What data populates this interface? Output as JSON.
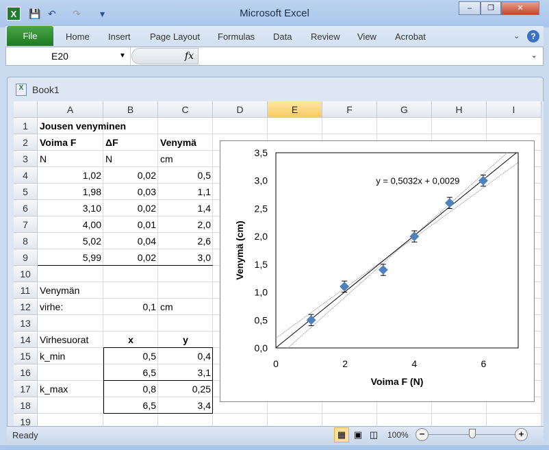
{
  "window": {
    "title": "Microsoft Excel",
    "minimize": "–",
    "restore": "❐",
    "close": "✕"
  },
  "qat": {
    "save": "💾",
    "undo": "↶",
    "redo": "↷",
    "customize": "▾"
  },
  "ribbon": {
    "tabs": [
      "File",
      "Home",
      "Insert",
      "Page Layout",
      "Formulas",
      "Data",
      "Review",
      "View",
      "Acrobat"
    ],
    "help": "?",
    "minimize": "♡"
  },
  "formula_bar": {
    "name_box": "E20",
    "fx": "fx",
    "value": ""
  },
  "workbook": {
    "title": "Book1"
  },
  "columns": [
    "A",
    "B",
    "C",
    "D",
    "E",
    "F",
    "G",
    "H",
    "I"
  ],
  "selected_column": "E",
  "rows": [
    "1",
    "2",
    "3",
    "4",
    "5",
    "6",
    "7",
    "8",
    "9",
    "10",
    "11",
    "12",
    "13",
    "14",
    "15",
    "16",
    "17",
    "18",
    "19"
  ],
  "cells": [
    {
      "ref": "A1",
      "v": "Jousen venyminen",
      "bold": true
    },
    {
      "ref": "A2",
      "v": "Voima F",
      "bold": true
    },
    {
      "ref": "B2",
      "v": "ΔF",
      "bold": true
    },
    {
      "ref": "C2",
      "v": "Venymä",
      "bold": true
    },
    {
      "ref": "A3",
      "v": "N"
    },
    {
      "ref": "B3",
      "v": "N"
    },
    {
      "ref": "C3",
      "v": "cm"
    },
    {
      "ref": "A4",
      "v": "1,02"
    },
    {
      "ref": "B4",
      "v": "0,02"
    },
    {
      "ref": "C4",
      "v": "0,5"
    },
    {
      "ref": "A5",
      "v": "1,98"
    },
    {
      "ref": "B5",
      "v": "0,03"
    },
    {
      "ref": "C5",
      "v": "1,1"
    },
    {
      "ref": "A6",
      "v": "3,10"
    },
    {
      "ref": "B6",
      "v": "0,02"
    },
    {
      "ref": "C6",
      "v": "1,4"
    },
    {
      "ref": "A7",
      "v": "4,00"
    },
    {
      "ref": "B7",
      "v": "0,01"
    },
    {
      "ref": "C7",
      "v": "2,0"
    },
    {
      "ref": "A8",
      "v": "5,02"
    },
    {
      "ref": "B8",
      "v": "0,04"
    },
    {
      "ref": "C8",
      "v": "2,6"
    },
    {
      "ref": "A9",
      "v": "5,99"
    },
    {
      "ref": "B9",
      "v": "0,02"
    },
    {
      "ref": "C9",
      "v": "3,0"
    },
    {
      "ref": "A11",
      "v": "Venymän"
    },
    {
      "ref": "A12",
      "v": "virhe:"
    },
    {
      "ref": "B12",
      "v": "0,1"
    },
    {
      "ref": "C12",
      "v": "cm"
    },
    {
      "ref": "A14",
      "v": "Virhesuorat"
    },
    {
      "ref": "B14",
      "v": "x",
      "bold": true,
      "center": true
    },
    {
      "ref": "C14",
      "v": "y",
      "bold": true,
      "center": true
    },
    {
      "ref": "A15",
      "v": "k_min"
    },
    {
      "ref": "B15",
      "v": "0,5"
    },
    {
      "ref": "C15",
      "v": "0,4"
    },
    {
      "ref": "B16",
      "v": "6,5"
    },
    {
      "ref": "C16",
      "v": "3,1"
    },
    {
      "ref": "A17",
      "v": "k_max"
    },
    {
      "ref": "B17",
      "v": "0,8"
    },
    {
      "ref": "C17",
      "v": "0,25"
    },
    {
      "ref": "B18",
      "v": "6,5"
    },
    {
      "ref": "C18",
      "v": "3,4"
    }
  ],
  "chart_data": {
    "type": "scatter",
    "xlabel": "Voima F (N)",
    "ylabel": "Venymä (cm)",
    "xlim": [
      0,
      7
    ],
    "ylim": [
      0,
      3.5
    ],
    "xticks": [
      "0",
      "2",
      "4",
      "6"
    ],
    "xtick_values": [
      0,
      2,
      4,
      6
    ],
    "yticks": [
      "0,0",
      "0,5",
      "1,0",
      "1,5",
      "2,0",
      "2,5",
      "3,0",
      "3,5"
    ],
    "ytick_values": [
      0,
      0.5,
      1,
      1.5,
      2,
      2.5,
      3,
      3.5
    ],
    "x": [
      1.02,
      1.98,
      3.1,
      4.0,
      5.02,
      5.99
    ],
    "y": [
      0.5,
      1.1,
      1.4,
      2.0,
      2.6,
      3.0
    ],
    "y_error": 0.1,
    "marker_color": "#4f81bd",
    "trendline": {
      "slope": 0.5032,
      "intercept": 0.0029,
      "label": "y = 0,5032x + 0,0029"
    },
    "error_lines": [
      {
        "points": [
          [
            0.5,
            0.4
          ],
          [
            6.5,
            3.1
          ]
        ]
      },
      {
        "points": [
          [
            0.8,
            0.25
          ],
          [
            6.5,
            3.4
          ]
        ]
      }
    ],
    "grid": false,
    "legend": "none"
  },
  "status": {
    "ready": "Ready",
    "zoom": "100%",
    "zoom_out": "−",
    "zoom_in": "+",
    "zoom_level_percent": 100
  }
}
